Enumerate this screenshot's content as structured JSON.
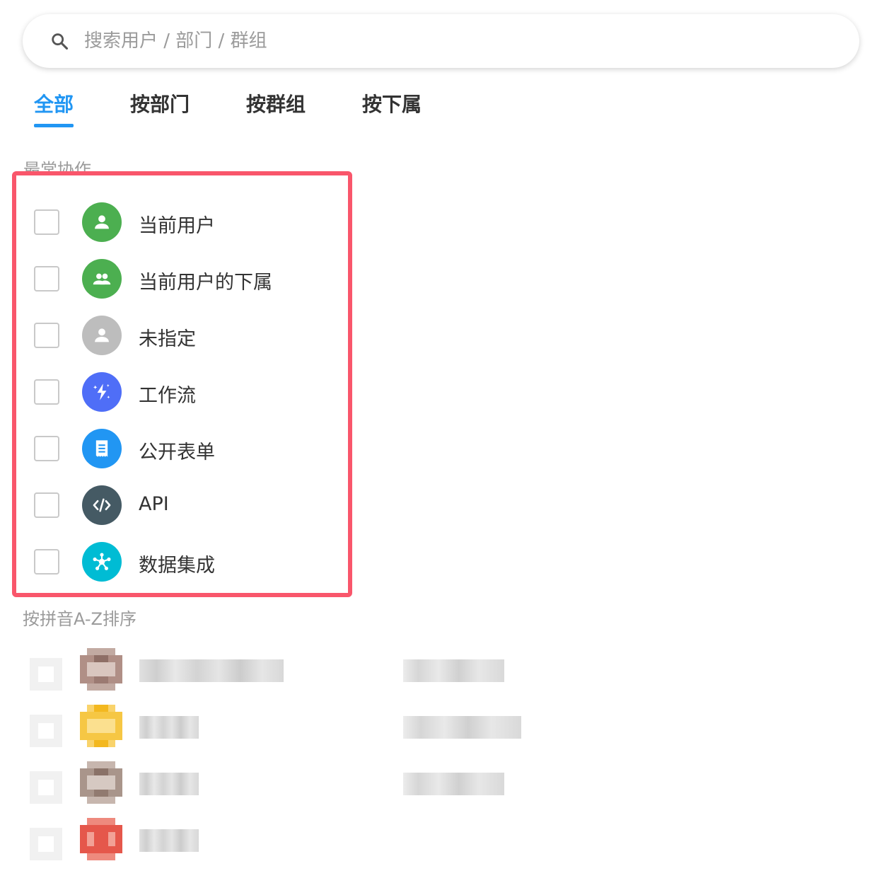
{
  "search": {
    "placeholder": "搜索用户 / 部门 / 群组"
  },
  "tabs": [
    {
      "label": "全部",
      "active": true
    },
    {
      "label": "按部门",
      "active": false
    },
    {
      "label": "按群组",
      "active": false
    },
    {
      "label": "按下属",
      "active": false
    }
  ],
  "sections": {
    "frequent_title": "最常协作",
    "az_title": "按拼音A-Z排序"
  },
  "frequent_items": [
    {
      "label": "当前用户",
      "icon": "person-icon",
      "color": "#4caf50",
      "checked": false
    },
    {
      "label": "当前用户的下属",
      "icon": "group-icon",
      "color": "#4caf50",
      "checked": false
    },
    {
      "label": "未指定",
      "icon": "person-icon",
      "color": "#bdbdbd",
      "checked": false
    },
    {
      "label": "工作流",
      "icon": "sparkle-bolt-icon",
      "color": "#4f6ef7",
      "checked": false
    },
    {
      "label": "公开表单",
      "icon": "form-icon",
      "color": "#2196f3",
      "checked": false
    },
    {
      "label": "API",
      "icon": "code-icon",
      "color": "#455a64",
      "checked": false
    },
    {
      "label": "数据集成",
      "icon": "integration-icon",
      "color": "#00bcd4",
      "checked": false
    }
  ],
  "colors": {
    "accent": "#2196f3",
    "highlight_border": "#f9566b",
    "muted_text": "#9b9b9b"
  },
  "blurred_rows_note_colors": [
    "#b08f86",
    "#f6c744",
    "#a9958b",
    "#e5574b"
  ]
}
